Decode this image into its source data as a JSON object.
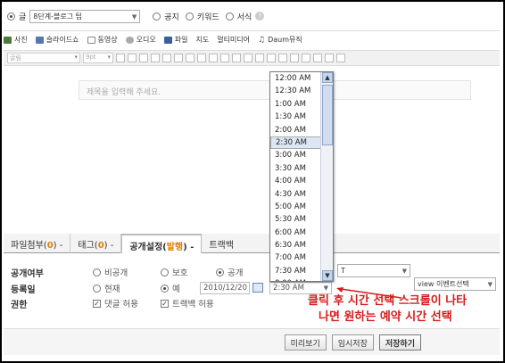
{
  "top_row": {
    "category_prefix": "글",
    "category_value": "8단계-블로그 팁",
    "radio_options": [
      "공지",
      "키워드",
      "서식"
    ],
    "help_glyph": "?"
  },
  "toolbar_media": [
    "사진",
    "슬라이드쇼",
    "동영상",
    "오디오",
    "파일",
    "지도",
    "멀티미디어",
    "Daum뮤직"
  ],
  "toolbar_format": {
    "font_select": "굴림",
    "size_select": "9pt"
  },
  "editor": {
    "title_placeholder": "제목을 입력해 주세요."
  },
  "tabs": [
    {
      "label": "파일첨부(",
      "count": "0",
      "suffix": ")",
      "arrow": "-"
    },
    {
      "label": "태그(",
      "count": "0",
      "suffix": ")",
      "arrow": "-"
    },
    {
      "label": "공개설정(",
      "count": "발행",
      "suffix": ")",
      "arrow": "-",
      "active": true
    },
    {
      "label": "트랙백",
      "count": "",
      "suffix": "",
      "arrow": ""
    }
  ],
  "settings": {
    "visibility_label": "공개여부",
    "visibility_options": [
      "비공개",
      "보호",
      "공개"
    ],
    "visibility_selected": "공개",
    "register_label": "등록일",
    "register_options": [
      "현재",
      "예"
    ],
    "register_selected": "예",
    "register_date": "2010/12/20",
    "register_time": "2:30 AM",
    "rights_label": "권한",
    "rights_options": [
      "댓글 허용",
      "트랙백 허용"
    ],
    "right_select_1": "T",
    "right_select_2": "view 이벤트선택"
  },
  "time_dropdown": {
    "times": [
      "12:00 AM",
      "12:30 AM",
      "1:00 AM",
      "1:30 AM",
      "2:00 AM",
      "2:30 AM",
      "3:00 AM",
      "3:30 AM",
      "4:00 AM",
      "4:30 AM",
      "5:00 AM",
      "5:30 AM",
      "6:00 AM",
      "6:30 AM",
      "7:00 AM",
      "7:30 AM",
      "8:00 AM"
    ],
    "selected": "2:30 AM"
  },
  "annotation": {
    "line1": "클릭 후 시간 선택 스크롤이 나타",
    "line2": "나면 원하는 예약 시간 선택",
    "color": "#d61c1c"
  },
  "buttons": {
    "preview": "미리보기",
    "temp_save": "임시저장",
    "save": "저장하기"
  },
  "colors": {
    "tab_highlight": "#e08000",
    "selected_time_bg": "#dde6f4",
    "scroll_thumb": "#d1ddef"
  }
}
